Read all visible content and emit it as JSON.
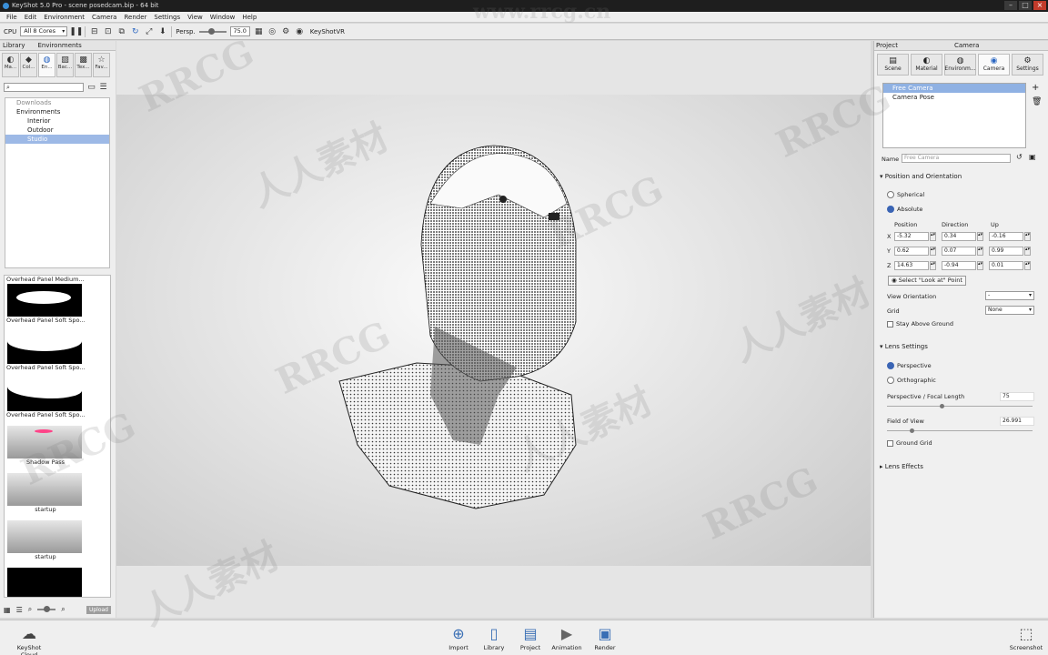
{
  "window": {
    "title": "KeyShot 5.0 Pro - scene posedcam.bip - 64 bit"
  },
  "menu": [
    "File",
    "Edit",
    "Environment",
    "Camera",
    "Render",
    "Settings",
    "View",
    "Window",
    "Help"
  ],
  "toolbar": {
    "cpu_label": "CPU",
    "cores": "All 8 Cores",
    "persp_label": "Persp.",
    "fov_value": "75.0",
    "keyshotvr": "KeyShotVR"
  },
  "library": {
    "header_tabs": [
      "Library",
      "Environments"
    ],
    "tabs": [
      "Ma...",
      "Col...",
      "En...",
      "Bac...",
      "Tex...",
      "Fav..."
    ],
    "tree": [
      "Downloads",
      "Environments",
      "Interior",
      "Outdoor",
      "Studio"
    ],
    "thumbs": [
      {
        "label": "Overhead Panel Medium..."
      },
      {
        "label": "Overhead Panel Soft Spo..."
      },
      {
        "label": "Overhead Panel Soft Spo..."
      },
      {
        "label": "Overhead Panel Soft Spo..."
      },
      {
        "label": "Shadow Pass"
      },
      {
        "label": "startup"
      },
      {
        "label": "startup"
      }
    ],
    "upload": "Upload"
  },
  "project": {
    "header_tabs": [
      "Project",
      "Camera"
    ],
    "tabs": [
      "Scene",
      "Material",
      "Environm...",
      "Camera",
      "Settings"
    ],
    "cameras": [
      "Free Camera",
      "Camera Pose"
    ],
    "name_label": "Name",
    "name_value": "Free Camera",
    "pos_section": "Position and Orientation",
    "spherical": "Spherical",
    "absolute": "Absolute",
    "col_position": "Position",
    "col_direction": "Direction",
    "col_up": "Up",
    "rows": [
      {
        "axis": "X",
        "pos": "-5.32",
        "dir": "0.34",
        "up": "-0.16"
      },
      {
        "axis": "Y",
        "pos": "0.62",
        "dir": "0.07",
        "up": "0.99"
      },
      {
        "axis": "Z",
        "pos": "14.63",
        "dir": "-0.94",
        "up": "0.01"
      }
    ],
    "lookat": "Select \"Look at\" Point",
    "view_orientation": "View Orientation",
    "view_orientation_value": "-",
    "grid": "Grid",
    "grid_value": "None",
    "stay_above": "Stay Above Ground",
    "lens_section": "Lens Settings",
    "perspective": "Perspective",
    "orthographic": "Orthographic",
    "focal_label": "Perspective / Focal Length",
    "focal_value": "75",
    "fov_label": "Field of View",
    "fov_value": "26.991",
    "ground_grid": "Ground Grid",
    "lens_effects": "Lens Effects"
  },
  "bottom": {
    "cloud": "KeyShot Cloud",
    "buttons": [
      "Import",
      "Library",
      "Project",
      "Animation",
      "Render"
    ],
    "screenshot": "Screenshot"
  },
  "watermarks": [
    "RRCG",
    "人人素材",
    "www.rrcg.cn"
  ]
}
